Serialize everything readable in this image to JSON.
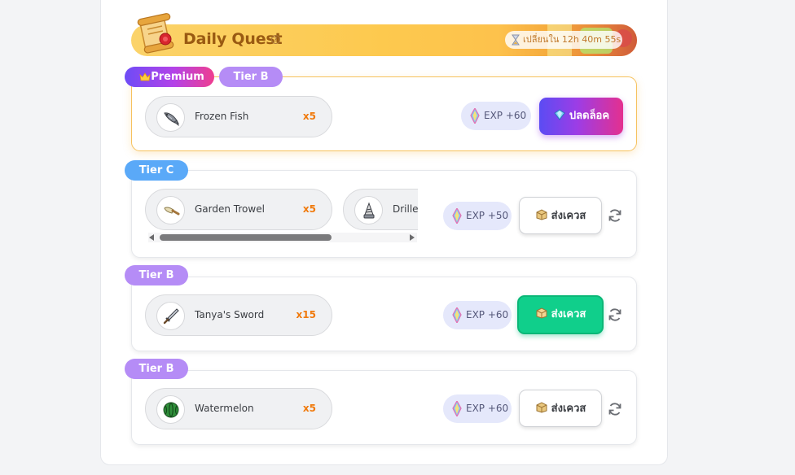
{
  "header": {
    "title": "Daily Quest",
    "help_icon": "?",
    "timer": "เปลี่ยนใน 12h 40m 55s",
    "accent": "#fdc94e"
  },
  "quests": [
    {
      "tags": [
        {
          "label": "Premium",
          "icon": "crown-icon"
        },
        {
          "label": "Tier B"
        }
      ],
      "items": [
        {
          "name": "Frozen Fish",
          "qty": "x5",
          "icon": "fish-icon"
        }
      ],
      "exp": "EXP +60",
      "action": {
        "label": "ปลดล็อค",
        "style": "unlock",
        "icon": "gem-icon"
      }
    },
    {
      "tags": [
        {
          "label": "Tier C"
        }
      ],
      "items": [
        {
          "name": "Garden Trowel",
          "qty": "x5",
          "icon": "trowel-icon"
        },
        {
          "name": "Driller",
          "qty": "",
          "icon": "drill-icon"
        }
      ],
      "exp": "EXP +50",
      "action": {
        "label": "ส่งเควส",
        "style": "white",
        "icon": "box-icon"
      }
    },
    {
      "tags": [
        {
          "label": "Tier B"
        }
      ],
      "items": [
        {
          "name": "Tanya's Sword",
          "qty": "x15",
          "icon": "sword-icon"
        }
      ],
      "exp": "EXP +60",
      "action": {
        "label": "ส่งเควส",
        "style": "green",
        "icon": "box-icon"
      }
    },
    {
      "tags": [
        {
          "label": "Tier B"
        }
      ],
      "items": [
        {
          "name": "Watermelon",
          "qty": "x5",
          "icon": "watermelon-icon"
        }
      ],
      "exp": "EXP +60",
      "action": {
        "label": "ส่งเควส",
        "style": "white",
        "icon": "box-icon"
      }
    }
  ]
}
